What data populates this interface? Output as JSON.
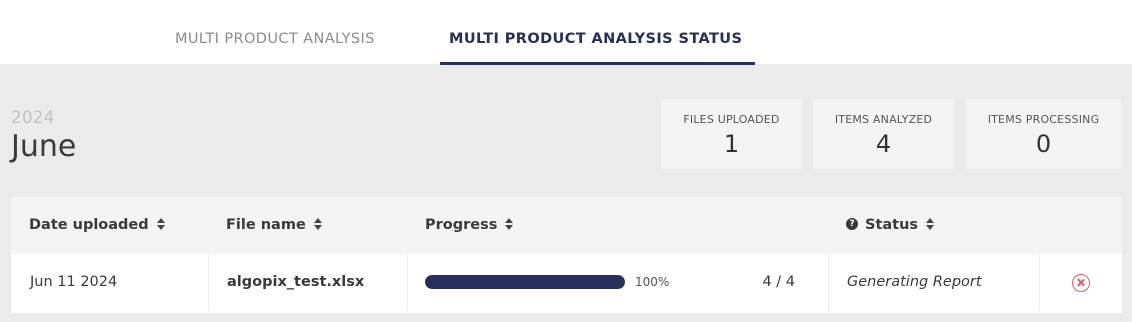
{
  "tabs": [
    {
      "label": "MULTI PRODUCT ANALYSIS"
    },
    {
      "label": "MULTI PRODUCT ANALYSIS STATUS",
      "active": true
    }
  ],
  "period": {
    "year": "2024",
    "month": "June"
  },
  "stats": [
    {
      "label": "FILES UPLOADED",
      "value": "1"
    },
    {
      "label": "ITEMS ANALYZED",
      "value": "4"
    },
    {
      "label": "ITEMS PROCESSING",
      "value": "0"
    }
  ],
  "table": {
    "columns": {
      "date": "Date uploaded",
      "file": "File name",
      "progress": "Progress",
      "status": "Status"
    },
    "rows": [
      {
        "date": "Jun 11 2024",
        "file": "algopix_test.xlsx",
        "progress_fraction": 1.0,
        "progress_label": "100%",
        "count": "4 / 4",
        "status": "Generating Report",
        "cancel_icon": "cancel-circle-icon"
      }
    ]
  },
  "colors": {
    "accent": "#26305a",
    "cancel": "#e06060"
  }
}
